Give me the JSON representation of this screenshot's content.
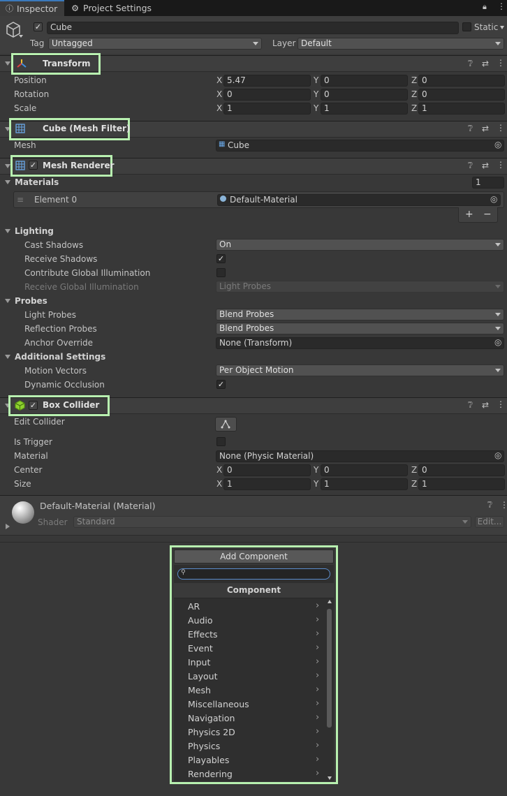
{
  "tabs": {
    "inspector": "Inspector",
    "project_settings": "Project Settings"
  },
  "object": {
    "name": "Cube",
    "static_label": "Static",
    "tag_label": "Tag",
    "tag_value": "Untagged",
    "layer_label": "Layer",
    "layer_value": "Default"
  },
  "transform": {
    "title": "Transform",
    "position_label": "Position",
    "rotation_label": "Rotation",
    "scale_label": "Scale",
    "axis_x": "X",
    "axis_y": "Y",
    "axis_z": "Z",
    "position": {
      "x": "5.47",
      "y": "0",
      "z": "0"
    },
    "rotation": {
      "x": "0",
      "y": "0",
      "z": "0"
    },
    "scale": {
      "x": "1",
      "y": "1",
      "z": "1"
    }
  },
  "mesh_filter": {
    "title": "Cube (Mesh Filter)",
    "mesh_label": "Mesh",
    "mesh_value": "Cube"
  },
  "mesh_renderer": {
    "title": "Mesh Renderer",
    "materials_label": "Materials",
    "materials_count": "1",
    "element0_label": "Element 0",
    "element0_value": "Default-Material",
    "plus": "+",
    "minus": "−",
    "lighting_label": "Lighting",
    "cast_shadows_label": "Cast Shadows",
    "cast_shadows_value": "On",
    "receive_shadows_label": "Receive Shadows",
    "contribute_gi_label": "Contribute Global Illumination",
    "receive_gi_label": "Receive Global Illumination",
    "receive_gi_value": "Light Probes",
    "probes_label": "Probes",
    "light_probes_label": "Light Probes",
    "light_probes_value": "Blend Probes",
    "reflection_probes_label": "Reflection Probes",
    "reflection_probes_value": "Blend Probes",
    "anchor_override_label": "Anchor Override",
    "anchor_override_value": "None (Transform)",
    "additional_label": "Additional Settings",
    "motion_vectors_label": "Motion Vectors",
    "motion_vectors_value": "Per Object Motion",
    "dynamic_occlusion_label": "Dynamic Occlusion"
  },
  "box_collider": {
    "title": "Box Collider",
    "edit_collider_label": "Edit Collider",
    "is_trigger_label": "Is Trigger",
    "material_label": "Material",
    "material_value": "None (Physic Material)",
    "center_label": "Center",
    "size_label": "Size",
    "center": {
      "x": "0",
      "y": "0",
      "z": "0"
    },
    "size": {
      "x": "1",
      "y": "1",
      "z": "1"
    }
  },
  "material": {
    "title": "Default-Material (Material)",
    "shader_label": "Shader",
    "shader_value": "Standard",
    "edit_label": "Edit..."
  },
  "add_component": {
    "button": "Add Component",
    "search_placeholder": "",
    "header": "Component",
    "items": [
      "AR",
      "Audio",
      "Effects",
      "Event",
      "Input",
      "Layout",
      "Mesh",
      "Miscellaneous",
      "Navigation",
      "Physics 2D",
      "Physics",
      "Playables",
      "Rendering"
    ]
  },
  "colors": {
    "background": "#383838",
    "header": "#3e3e3e",
    "highlight": "#b8f0b0",
    "field": "#2a2a2a",
    "tab_accent": "#3a79bb"
  }
}
